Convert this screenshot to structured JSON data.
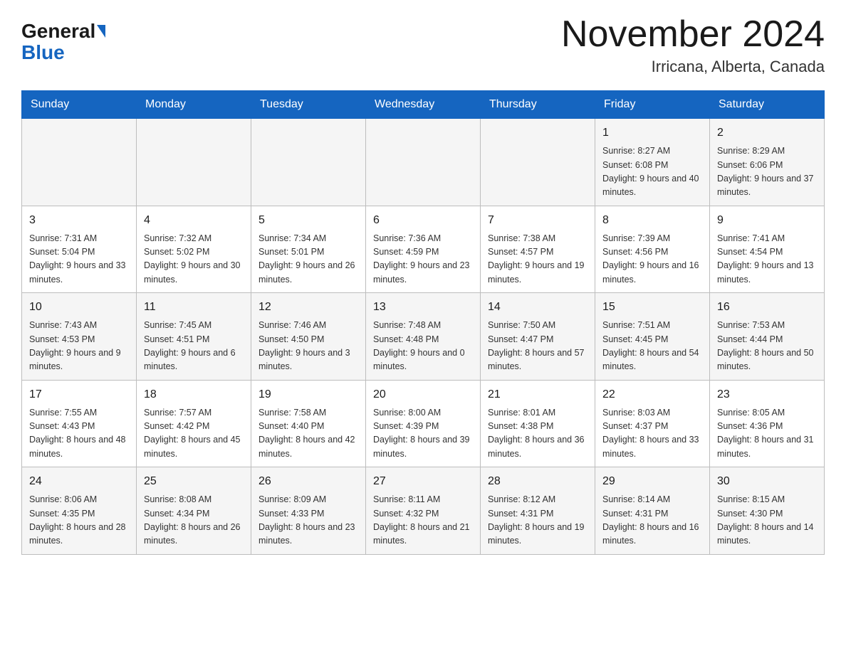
{
  "header": {
    "logo_general": "General",
    "logo_blue": "Blue",
    "month_year": "November 2024",
    "location": "Irricana, Alberta, Canada"
  },
  "days_of_week": [
    "Sunday",
    "Monday",
    "Tuesday",
    "Wednesday",
    "Thursday",
    "Friday",
    "Saturday"
  ],
  "weeks": [
    {
      "days": [
        {
          "num": "",
          "info": ""
        },
        {
          "num": "",
          "info": ""
        },
        {
          "num": "",
          "info": ""
        },
        {
          "num": "",
          "info": ""
        },
        {
          "num": "",
          "info": ""
        },
        {
          "num": "1",
          "info": "Sunrise: 8:27 AM\nSunset: 6:08 PM\nDaylight: 9 hours\nand 40 minutes."
        },
        {
          "num": "2",
          "info": "Sunrise: 8:29 AM\nSunset: 6:06 PM\nDaylight: 9 hours\nand 37 minutes."
        }
      ]
    },
    {
      "days": [
        {
          "num": "3",
          "info": "Sunrise: 7:31 AM\nSunset: 5:04 PM\nDaylight: 9 hours\nand 33 minutes."
        },
        {
          "num": "4",
          "info": "Sunrise: 7:32 AM\nSunset: 5:02 PM\nDaylight: 9 hours\nand 30 minutes."
        },
        {
          "num": "5",
          "info": "Sunrise: 7:34 AM\nSunset: 5:01 PM\nDaylight: 9 hours\nand 26 minutes."
        },
        {
          "num": "6",
          "info": "Sunrise: 7:36 AM\nSunset: 4:59 PM\nDaylight: 9 hours\nand 23 minutes."
        },
        {
          "num": "7",
          "info": "Sunrise: 7:38 AM\nSunset: 4:57 PM\nDaylight: 9 hours\nand 19 minutes."
        },
        {
          "num": "8",
          "info": "Sunrise: 7:39 AM\nSunset: 4:56 PM\nDaylight: 9 hours\nand 16 minutes."
        },
        {
          "num": "9",
          "info": "Sunrise: 7:41 AM\nSunset: 4:54 PM\nDaylight: 9 hours\nand 13 minutes."
        }
      ]
    },
    {
      "days": [
        {
          "num": "10",
          "info": "Sunrise: 7:43 AM\nSunset: 4:53 PM\nDaylight: 9 hours\nand 9 minutes."
        },
        {
          "num": "11",
          "info": "Sunrise: 7:45 AM\nSunset: 4:51 PM\nDaylight: 9 hours\nand 6 minutes."
        },
        {
          "num": "12",
          "info": "Sunrise: 7:46 AM\nSunset: 4:50 PM\nDaylight: 9 hours\nand 3 minutes."
        },
        {
          "num": "13",
          "info": "Sunrise: 7:48 AM\nSunset: 4:48 PM\nDaylight: 9 hours\nand 0 minutes."
        },
        {
          "num": "14",
          "info": "Sunrise: 7:50 AM\nSunset: 4:47 PM\nDaylight: 8 hours\nand 57 minutes."
        },
        {
          "num": "15",
          "info": "Sunrise: 7:51 AM\nSunset: 4:45 PM\nDaylight: 8 hours\nand 54 minutes."
        },
        {
          "num": "16",
          "info": "Sunrise: 7:53 AM\nSunset: 4:44 PM\nDaylight: 8 hours\nand 50 minutes."
        }
      ]
    },
    {
      "days": [
        {
          "num": "17",
          "info": "Sunrise: 7:55 AM\nSunset: 4:43 PM\nDaylight: 8 hours\nand 48 minutes."
        },
        {
          "num": "18",
          "info": "Sunrise: 7:57 AM\nSunset: 4:42 PM\nDaylight: 8 hours\nand 45 minutes."
        },
        {
          "num": "19",
          "info": "Sunrise: 7:58 AM\nSunset: 4:40 PM\nDaylight: 8 hours\nand 42 minutes."
        },
        {
          "num": "20",
          "info": "Sunrise: 8:00 AM\nSunset: 4:39 PM\nDaylight: 8 hours\nand 39 minutes."
        },
        {
          "num": "21",
          "info": "Sunrise: 8:01 AM\nSunset: 4:38 PM\nDaylight: 8 hours\nand 36 minutes."
        },
        {
          "num": "22",
          "info": "Sunrise: 8:03 AM\nSunset: 4:37 PM\nDaylight: 8 hours\nand 33 minutes."
        },
        {
          "num": "23",
          "info": "Sunrise: 8:05 AM\nSunset: 4:36 PM\nDaylight: 8 hours\nand 31 minutes."
        }
      ]
    },
    {
      "days": [
        {
          "num": "24",
          "info": "Sunrise: 8:06 AM\nSunset: 4:35 PM\nDaylight: 8 hours\nand 28 minutes."
        },
        {
          "num": "25",
          "info": "Sunrise: 8:08 AM\nSunset: 4:34 PM\nDaylight: 8 hours\nand 26 minutes."
        },
        {
          "num": "26",
          "info": "Sunrise: 8:09 AM\nSunset: 4:33 PM\nDaylight: 8 hours\nand 23 minutes."
        },
        {
          "num": "27",
          "info": "Sunrise: 8:11 AM\nSunset: 4:32 PM\nDaylight: 8 hours\nand 21 minutes."
        },
        {
          "num": "28",
          "info": "Sunrise: 8:12 AM\nSunset: 4:31 PM\nDaylight: 8 hours\nand 19 minutes."
        },
        {
          "num": "29",
          "info": "Sunrise: 8:14 AM\nSunset: 4:31 PM\nDaylight: 8 hours\nand 16 minutes."
        },
        {
          "num": "30",
          "info": "Sunrise: 8:15 AM\nSunset: 4:30 PM\nDaylight: 8 hours\nand 14 minutes."
        }
      ]
    }
  ]
}
